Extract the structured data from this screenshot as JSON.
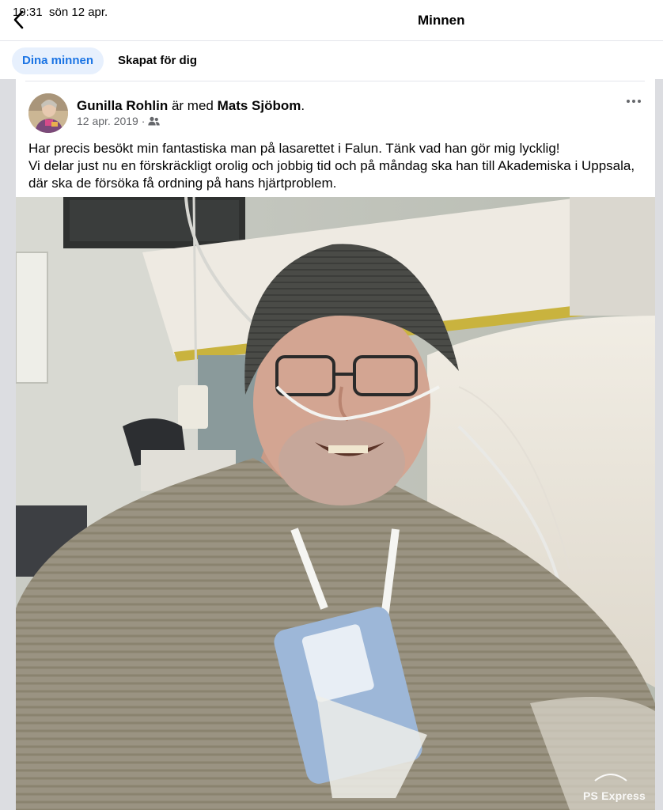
{
  "status": {
    "time": "19:31",
    "date": "sön 12 apr."
  },
  "nav": {
    "title": "Minnen",
    "back_icon": "chevron-left-icon"
  },
  "tabs": [
    {
      "label": "Dina minnen",
      "active": true
    },
    {
      "label": "Skapat för dig",
      "active": false
    }
  ],
  "post": {
    "author": "Gunilla Rohlin",
    "connector": " är med ",
    "tagged": "Mats Sjöbom",
    "tagged_suffix": ".",
    "date": "12 apr. 2019 ·",
    "audience_icon": "friends-icon",
    "more_icon": "more-horizontal-icon",
    "text_lines": [
      "Har precis besökt min fantastiska man på lasarettet i Falun. Tänk vad han gör mig lycklig!",
      "Vi delar just nu en förskräckligt orolig och jobbig tid och på måndag ska han till Akademiska i Uppsala, där ska de försöka få ordning på hans hjärtproblem."
    ]
  },
  "photo": {
    "watermark": "PS Express"
  },
  "colors": {
    "accent": "#1b74e4",
    "tab_active_bg": "#e7f0fd",
    "frame": "#dcdde1",
    "meta": "#65676b"
  }
}
